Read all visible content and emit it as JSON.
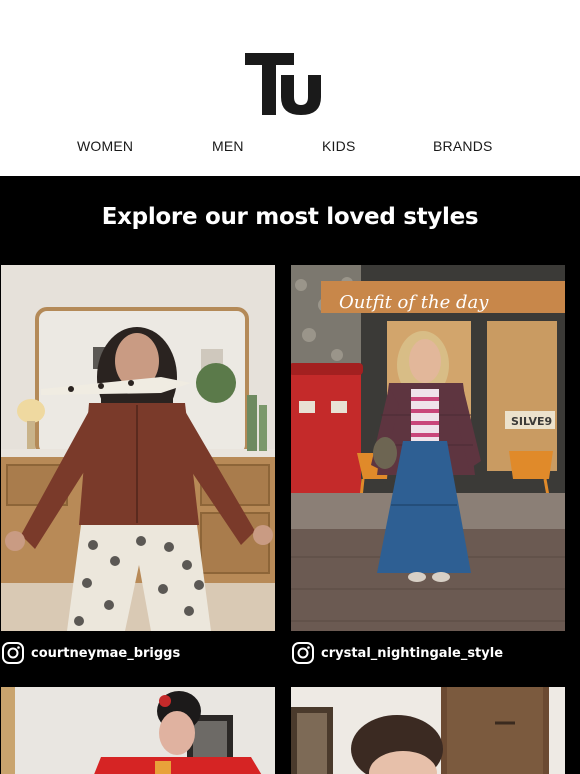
{
  "brand": {
    "logo_text": "Tu"
  },
  "nav": {
    "items": [
      {
        "label": "WOMEN"
      },
      {
        "label": "MEN"
      },
      {
        "label": "KIDS"
      },
      {
        "label": "BRANDS"
      }
    ]
  },
  "section": {
    "title": "Explore our most loved styles",
    "posts": [
      {
        "handle": "courtneymae_briggs",
        "icon": "instagram-icon"
      },
      {
        "handle": "crystal_nightingale_style",
        "icon": "instagram-icon",
        "overlay_text": "Outfit of the day",
        "shop_sign": "SILVE9"
      }
    ]
  },
  "colors": {
    "header_bg": "#ffffff",
    "section_bg": "#000000",
    "text_light": "#ffffff",
    "text_dark": "#1a1a1a"
  }
}
